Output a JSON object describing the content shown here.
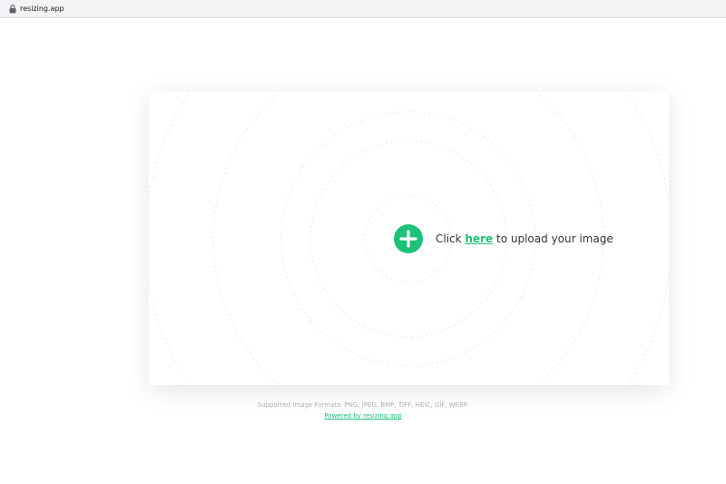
{
  "browser": {
    "url": "resizing.app",
    "lock_icon": "lock-icon"
  },
  "upload": {
    "prefix": "Click ",
    "link": "here",
    "suffix": " to upload your image",
    "button_icon": "plus-icon"
  },
  "footer": {
    "formats": "Supported Image Formats: PNG, JPEG, BMP, TIFF, HEIC, GIF, WEBP.",
    "powered": "Powered by resizing.app"
  },
  "colors": {
    "accent": "#1ec178",
    "text": "#333333",
    "muted": "#b0b0b0"
  }
}
